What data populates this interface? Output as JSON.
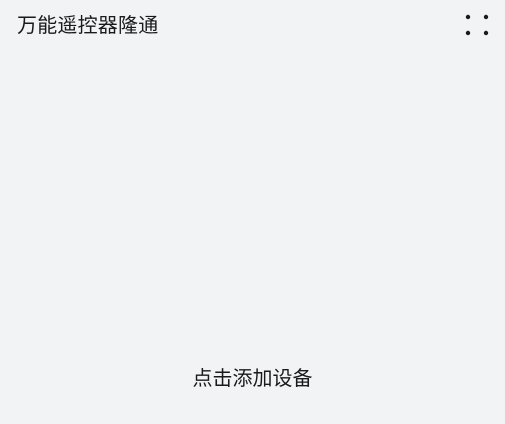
{
  "header": {
    "title": "万能遥控器隆通",
    "menu_icon": "four-dots-grid-icon"
  },
  "main": {
    "add_device_label": "点击添加设备"
  },
  "colors": {
    "background": "#f2f3f5",
    "text": "#1a1a1a"
  }
}
